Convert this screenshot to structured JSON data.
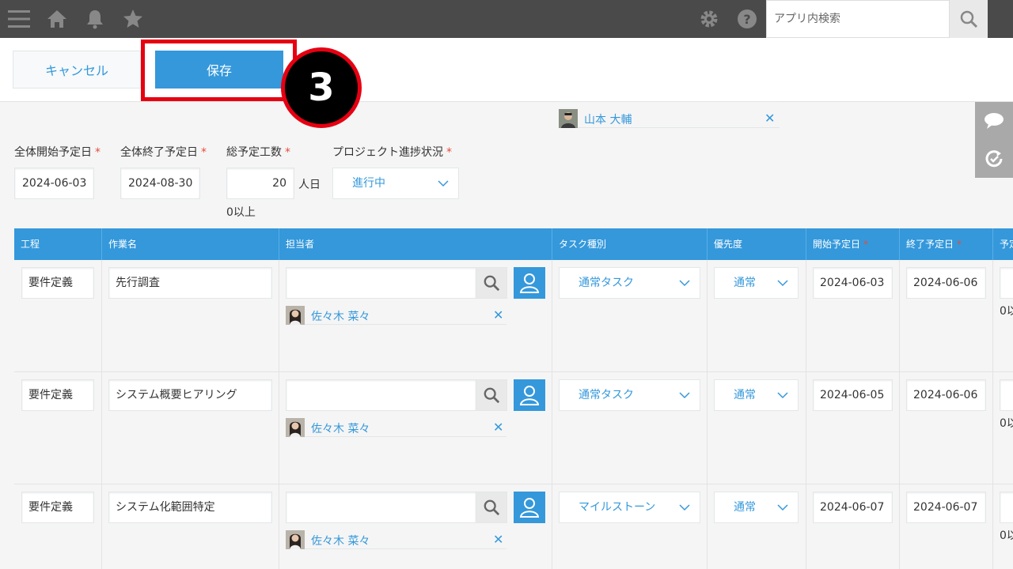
{
  "search": {
    "placeholder": "アプリ内検索"
  },
  "actions": {
    "cancel_label": "キャンセル",
    "save_label": "保存",
    "step_number": "3"
  },
  "member_list": {
    "name": "山本 大輔"
  },
  "fields": {
    "start": {
      "label": "全体開始予定日",
      "value": "2024-06-03"
    },
    "end": {
      "label": "全体終了予定日",
      "value": "2024-08-30"
    },
    "effort": {
      "label": "総予定工数",
      "value": "20",
      "unit": "人日",
      "note": "0以上"
    },
    "status": {
      "label": "プロジェクト進捗状況",
      "value": "進行中"
    }
  },
  "table": {
    "headers": [
      "工程",
      "作業名",
      "担当者",
      "タスク種別",
      "優先度",
      "開始予定日",
      "終了予定日",
      "予定"
    ],
    "rows": [
      {
        "phase": "要件定義",
        "task": "先行調査",
        "assignee": "佐々木 菜々",
        "type": "通常タスク",
        "priority": "通常",
        "start": "2024-06-03",
        "end": "2024-06-06",
        "note": "0以"
      },
      {
        "phase": "要件定義",
        "task": "システム概要ヒアリング",
        "assignee": "佐々木 菜々",
        "type": "通常タスク",
        "priority": "通常",
        "start": "2024-06-05",
        "end": "2024-06-06",
        "note": "0以"
      },
      {
        "phase": "要件定義",
        "task": "システム化範囲特定",
        "assignee": "佐々木 菜々",
        "type": "マイルストーン",
        "priority": "通常",
        "start": "2024-06-07",
        "end": "2024-06-07",
        "note": "0以"
      }
    ]
  },
  "colors": {
    "topbar": "#4a4a4a",
    "accent": "#3498db",
    "highlight": "#e60012",
    "required": "#e74c3c"
  }
}
